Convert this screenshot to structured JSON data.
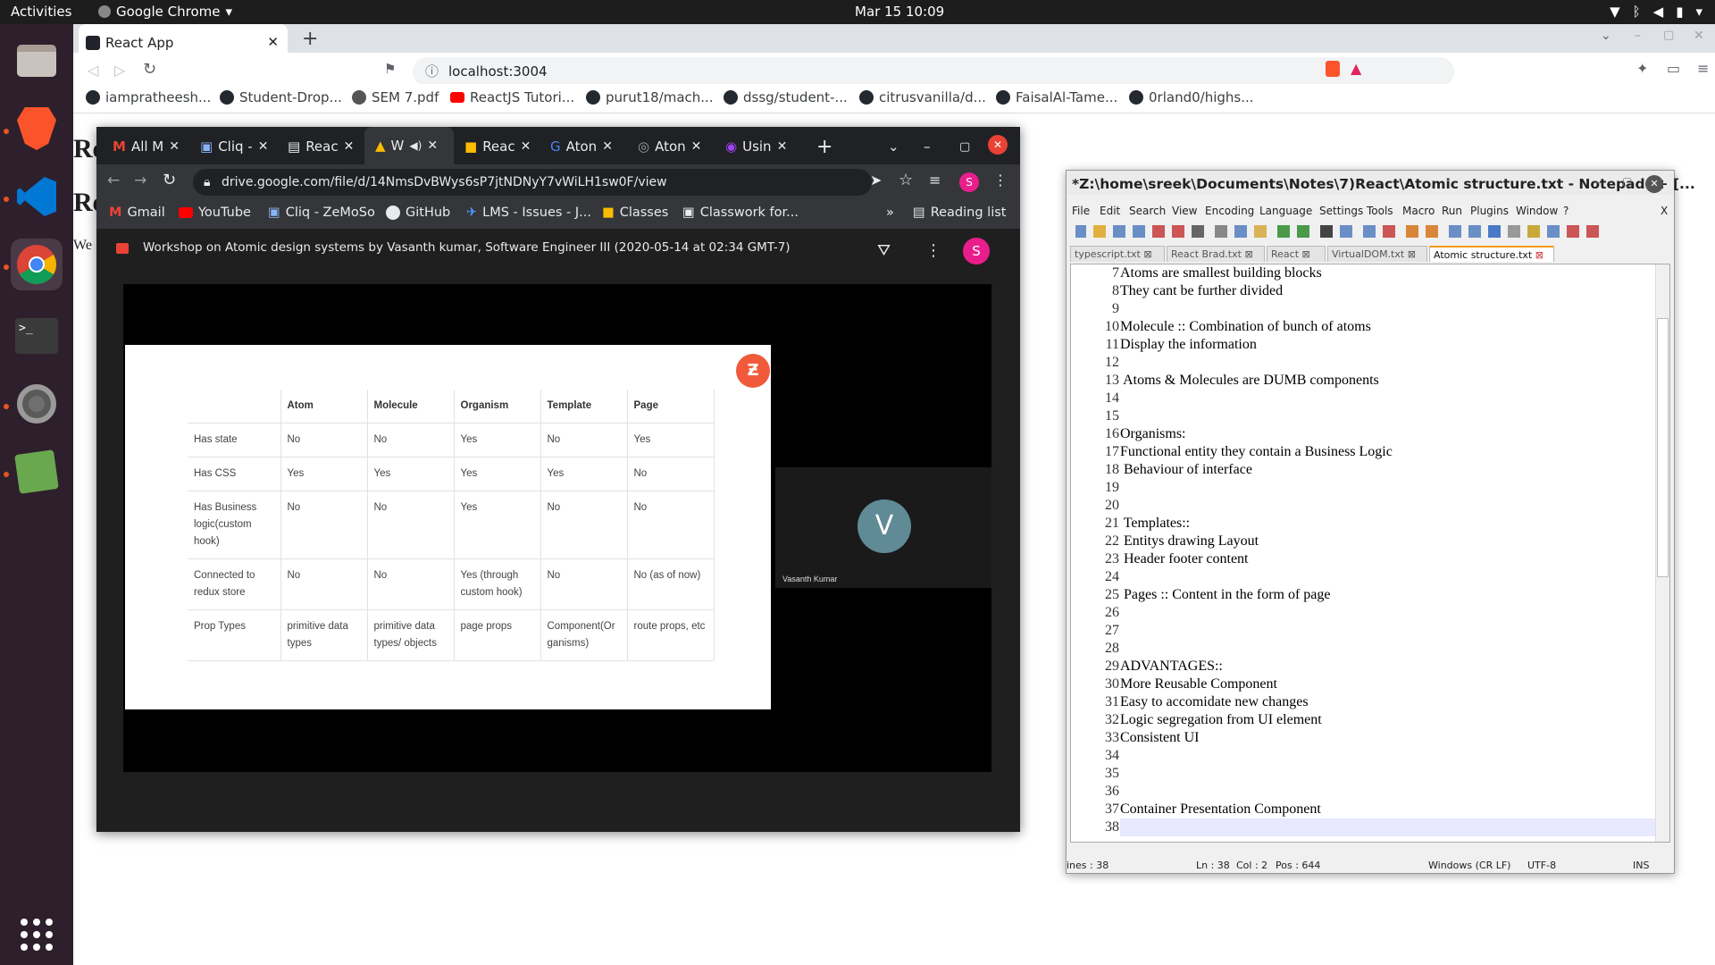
{
  "topbar": {
    "activities": "Activities",
    "app_name": "Google Chrome",
    "clock": "Mar 15  10:09"
  },
  "dock": {
    "items": [
      "files-icon",
      "brave-icon",
      "vscode-icon",
      "chrome-icon",
      "terminal-icon",
      "settings-icon",
      "rhythmbox-icon",
      "apps-grid-icon"
    ]
  },
  "main_chrome": {
    "tab_title": "React App",
    "url": "localhost:3004",
    "bookmarks": [
      "iampratheesh...",
      "Student-Drop...",
      "SEM 7.pdf",
      "ReactJS Tutori...",
      "purut18/mach...",
      "dssg/student-...",
      "citrusvanilla/d...",
      "FaisalAl-Tame...",
      "0rland0/highs..."
    ],
    "page_fragments": [
      "Re",
      "Re",
      "We"
    ]
  },
  "inner_chrome": {
    "tabs": [
      "All M",
      "Cliq -",
      "Reac",
      "W",
      "Reac",
      "Aton",
      "Aton",
      "Usin"
    ],
    "url": "drive.google.com/file/d/14NmsDvBWys6sP7jtNDNyY7vWiLH1sw0F/view",
    "bookmarks": [
      "Gmail",
      "YouTube",
      "Cliq - ZeMoSo",
      "GitHub",
      "LMS - Issues - J...",
      "Classes",
      "Classwork for..."
    ],
    "more": "»",
    "reading_list": "Reading list",
    "avatar_letter": "S",
    "drive_title": "Workshop on Atomic design systems by Vasanth kumar, Software Engineer III (2020-05-14 at 02:34 GMT-7)",
    "presenter_initial": "V",
    "presenter_name": "Vasanth Kumar",
    "slide_table": {
      "headers": [
        "",
        "Atom",
        "Molecule",
        "Organism",
        "Template",
        "Page"
      ],
      "rows": [
        [
          "Has state",
          "No",
          "No",
          "Yes",
          "No",
          "Yes"
        ],
        [
          "Has CSS",
          "Yes",
          "Yes",
          "Yes",
          "Yes",
          "No"
        ],
        [
          "Has Business logic(custom hook)",
          "No",
          "No",
          "Yes",
          "No",
          "No"
        ],
        [
          "Connected to redux store",
          "No",
          "No",
          "Yes (through custom hook)",
          "No",
          "No (as of now)"
        ],
        [
          "Prop Types",
          "primitive data types",
          "primitive data types/ objects",
          "page props",
          "Component(Or ganisms)",
          "route props, etc"
        ]
      ]
    }
  },
  "notepad": {
    "title": "*Z:\\home\\sreek\\Documents\\Notes\\7)React\\Atomic structure.txt - Notepad++ [...",
    "menu": [
      "File",
      "Edit",
      "Search",
      "View",
      "Encoding",
      "Language",
      "Settings",
      "Tools",
      "Macro",
      "Run",
      "Plugins",
      "Window",
      "?"
    ],
    "close_x": "X",
    "tabs": [
      "typescript.txt",
      "React Brad.txt",
      "React",
      "VirtualDOM.txt",
      "Atomic structure.txt"
    ],
    "lines": [
      {
        "n": "7",
        "t": "Atoms are smallest building blocks"
      },
      {
        "n": "8",
        "t": "They cant be further divided"
      },
      {
        "n": "9",
        "t": ""
      },
      {
        "n": "10",
        "t": "Molecule :: Combination of bunch of atoms"
      },
      {
        "n": "11",
        "t": "Display the information"
      },
      {
        "n": "12",
        "t": ""
      },
      {
        "n": "13",
        "t": " Atoms & Molecules are DUMB components"
      },
      {
        "n": "14",
        "t": ""
      },
      {
        "n": "15",
        "t": ""
      },
      {
        "n": "16",
        "t": "Organisms:"
      },
      {
        "n": "17",
        "t": "Functional entity they contain a Business Logic"
      },
      {
        "n": "18",
        "t": " Behaviour of interface"
      },
      {
        "n": "19",
        "t": ""
      },
      {
        "n": "20",
        "t": ""
      },
      {
        "n": "21",
        "t": " Templates::"
      },
      {
        "n": "22",
        "t": " Entitys drawing Layout"
      },
      {
        "n": "23",
        "t": " Header footer content"
      },
      {
        "n": "24",
        "t": ""
      },
      {
        "n": "25",
        "t": " Pages :: Content in the form of page"
      },
      {
        "n": "26",
        "t": ""
      },
      {
        "n": "27",
        "t": ""
      },
      {
        "n": "28",
        "t": ""
      },
      {
        "n": "29",
        "t": "ADVANTAGES::"
      },
      {
        "n": "30",
        "t": "More Reusable Component"
      },
      {
        "n": "31",
        "t": "Easy to accomidate new changes"
      },
      {
        "n": "32",
        "t": "Logic segregation from UI element"
      },
      {
        "n": "33",
        "t": "Consistent UI"
      },
      {
        "n": "34",
        "t": ""
      },
      {
        "n": "35",
        "t": ""
      },
      {
        "n": "36",
        "t": ""
      },
      {
        "n": "37",
        "t": "Container Presentation Component"
      },
      {
        "n": "38",
        "t": ""
      }
    ],
    "status": {
      "lines": "ines : 38",
      "ln": "Ln : 38",
      "col": "Col : 2",
      "pos": "Pos : 644",
      "eol": "Windows (CR LF)",
      "enc": "UTF-8",
      "mode": "INS"
    }
  },
  "colors": {
    "ubuntu_orange": "#e95420",
    "avatar_pink": "#e91e8c",
    "zemoso_orange": "#f05a3a",
    "presenter_avatar": "#5f8a96"
  }
}
